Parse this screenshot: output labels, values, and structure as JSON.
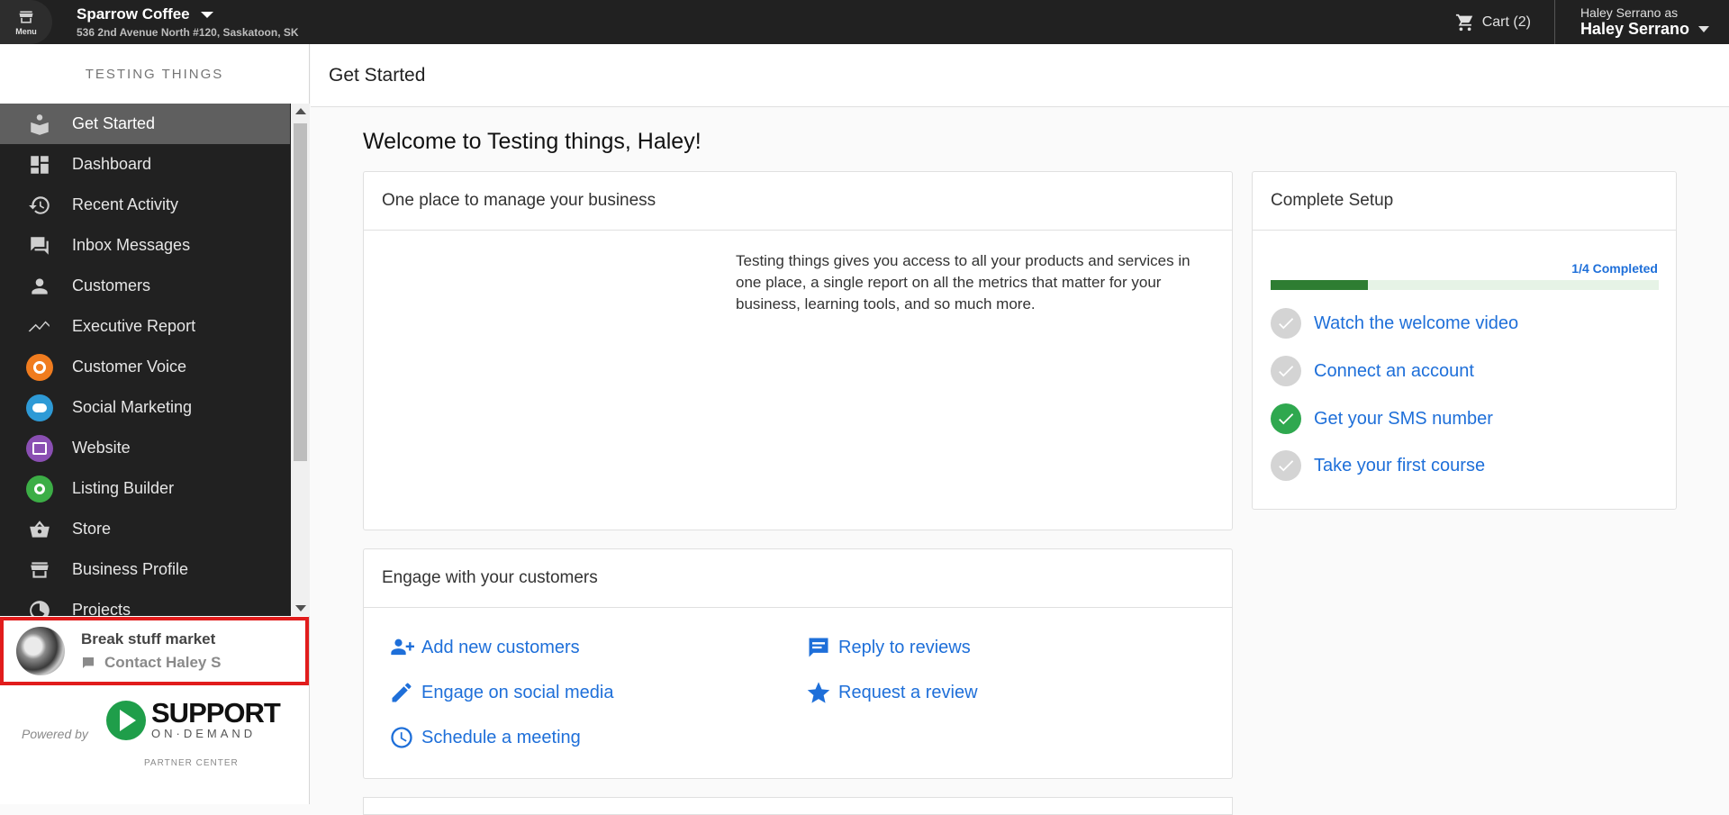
{
  "topbar": {
    "menu_label": "Menu",
    "business_name": "Sparrow Coffee",
    "business_address": "536 2nd Avenue North #120, Saskatoon, SK",
    "cart_label": "Cart (2)",
    "user_as": "Haley Serrano as",
    "user_name": "Haley Serrano"
  },
  "sidebar": {
    "title": "TESTING THINGS",
    "items": [
      {
        "label": "Get Started",
        "icon": "get-started-icon"
      },
      {
        "label": "Dashboard",
        "icon": "dashboard-icon"
      },
      {
        "label": "Recent Activity",
        "icon": "history-icon"
      },
      {
        "label": "Inbox Messages",
        "icon": "chat-icon"
      },
      {
        "label": "Customers",
        "icon": "person-icon"
      },
      {
        "label": "Executive Report",
        "icon": "trend-icon"
      },
      {
        "label": "Customer Voice",
        "icon": "customer-voice-icon"
      },
      {
        "label": "Social Marketing",
        "icon": "social-marketing-icon"
      },
      {
        "label": "Website",
        "icon": "website-icon"
      },
      {
        "label": "Listing Builder",
        "icon": "listing-builder-icon"
      },
      {
        "label": "Store",
        "icon": "basket-icon"
      },
      {
        "label": "Business Profile",
        "icon": "storefront-icon"
      },
      {
        "label": "Projects",
        "icon": "projects-icon"
      }
    ],
    "contact": {
      "name": "Break stuff market",
      "action": "Contact Haley S"
    },
    "powered_by": "Powered by",
    "logo_line1": "SUPPORT",
    "logo_line2": "ON·DEMAND",
    "partner_center": "PARTNER CENTER"
  },
  "main": {
    "page_title": "Get Started",
    "welcome": "Welcome to Testing things, Haley!",
    "manage_card": {
      "title": "One place to manage your business",
      "description": "Testing things gives you access to all your products and services in one place, a single report on all the metrics that matter for your business, learning tools, and so much more."
    },
    "engage_card": {
      "title": "Engage with your customers",
      "actions": [
        "Add new customers",
        "Reply to reviews",
        "Engage on social media",
        "Request a review",
        "Schedule a meeting"
      ]
    },
    "setup_card": {
      "title": "Complete Setup",
      "progress_label": "1/4 Completed",
      "progress_fraction": 0.25,
      "tasks": [
        {
          "label": "Watch the welcome video",
          "done": false
        },
        {
          "label": "Connect an account",
          "done": false
        },
        {
          "label": "Get your SMS number",
          "done": true
        },
        {
          "label": "Take your first course",
          "done": false
        }
      ]
    }
  },
  "colors": {
    "accent_blue": "#1e6fd9",
    "progress_green": "#2e7d32",
    "done_green": "#2fa84f",
    "highlight_red": "#e11c1c",
    "customer_voice": "#f07c1f",
    "social_marketing": "#2e9ad6",
    "website": "#8a4fb3",
    "listing_builder": "#3cae46"
  }
}
